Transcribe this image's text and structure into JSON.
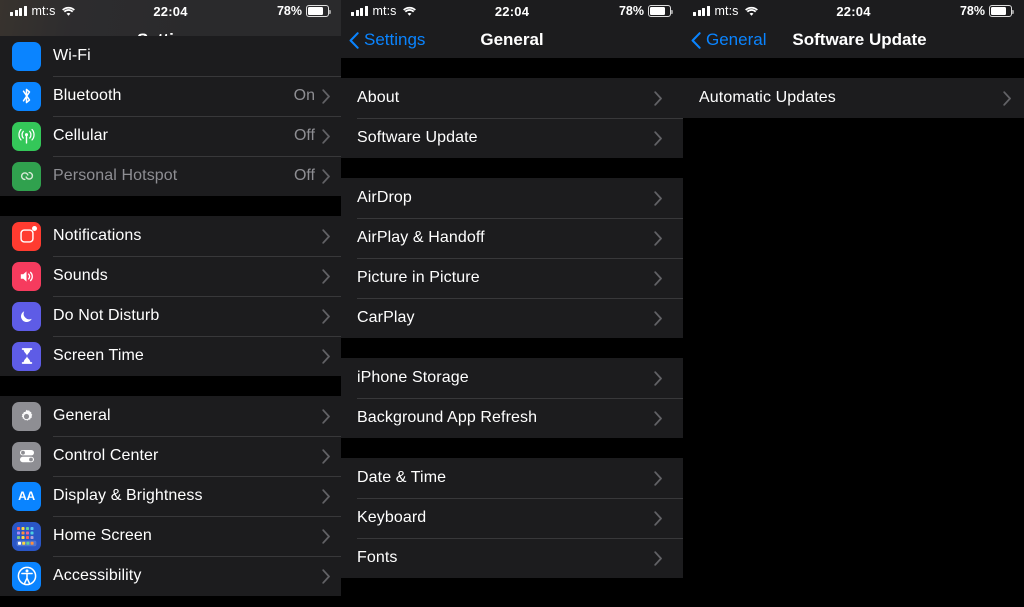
{
  "statusbar": {
    "carrier": "mt:s",
    "time": "22:04",
    "battery_percent": "78%",
    "signal_icon": "cellular-bars-icon",
    "wifi_icon": "wifi-icon",
    "battery_icon": "battery-icon",
    "battery_level": 78
  },
  "colors": {
    "accent": "#0a84ff",
    "row_bg": "#1c1c1e",
    "page_bg": "#000000",
    "separator": "#38383a",
    "secondary_text": "#8e8e93"
  },
  "panels": {
    "left": {
      "title": "Settings",
      "groups": [
        {
          "rows": [
            {
              "label": "Wi-Fi",
              "value": "",
              "icon": "wifi-settings-icon",
              "icon_color": "#0a84ff",
              "partial": true
            },
            {
              "label": "Bluetooth",
              "value": "On",
              "icon": "bluetooth-icon",
              "icon_color": "#0a84ff"
            },
            {
              "label": "Cellular",
              "value": "Off",
              "icon": "cellular-icon",
              "icon_color": "#34c759"
            },
            {
              "label": "Personal Hotspot",
              "value": "Off",
              "icon": "personal-hotspot-icon",
              "icon_color": "#30a14e",
              "dimmed": true
            }
          ]
        },
        {
          "rows": [
            {
              "label": "Notifications",
              "value": "",
              "icon": "notifications-icon",
              "icon_color": "#ff3b30"
            },
            {
              "label": "Sounds",
              "value": "",
              "icon": "sounds-icon",
              "icon_color": "#f63b5e"
            },
            {
              "label": "Do Not Disturb",
              "value": "",
              "icon": "do-not-disturb-icon",
              "icon_color": "#5e5ce6"
            },
            {
              "label": "Screen Time",
              "value": "",
              "icon": "screen-time-icon",
              "icon_color": "#5e5ce6"
            }
          ]
        },
        {
          "rows": [
            {
              "label": "General",
              "value": "",
              "icon": "general-gear-icon",
              "icon_color": "#8e8e93"
            },
            {
              "label": "Control Center",
              "value": "",
              "icon": "control-center-icon",
              "icon_color": "#8e8e93"
            },
            {
              "label": "Display & Brightness",
              "value": "",
              "icon": "display-brightness-icon",
              "icon_color": "#0a84ff"
            },
            {
              "label": "Home Screen",
              "value": "",
              "icon": "home-screen-icon",
              "icon_color": "#2a56c6"
            },
            {
              "label": "Accessibility",
              "value": "",
              "icon": "accessibility-icon",
              "icon_color": "#0a84ff"
            }
          ]
        }
      ]
    },
    "middle": {
      "back_label": "Settings",
      "title": "General",
      "groups": [
        {
          "rows": [
            {
              "label": "About"
            },
            {
              "label": "Software Update"
            }
          ]
        },
        {
          "rows": [
            {
              "label": "AirDrop"
            },
            {
              "label": "AirPlay & Handoff"
            },
            {
              "label": "Picture in Picture"
            },
            {
              "label": "CarPlay"
            }
          ]
        },
        {
          "rows": [
            {
              "label": "iPhone Storage"
            },
            {
              "label": "Background App Refresh"
            }
          ]
        },
        {
          "rows": [
            {
              "label": "Date & Time"
            },
            {
              "label": "Keyboard"
            },
            {
              "label": "Fonts"
            }
          ]
        }
      ]
    },
    "right": {
      "back_label": "General",
      "title": "Software Update",
      "groups": [
        {
          "rows": [
            {
              "label": "Automatic Updates"
            }
          ]
        }
      ]
    }
  }
}
